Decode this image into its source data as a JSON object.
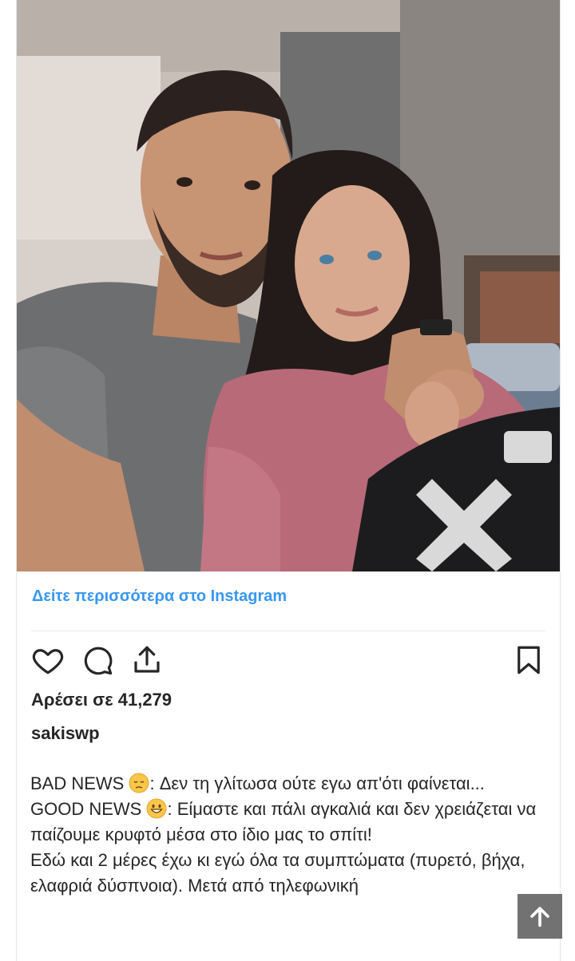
{
  "post": {
    "view_more_label": "Δείτε περισσότερα στο Instagram",
    "likes_text": "Αρέσει σε 41,279",
    "username": "sakiswp",
    "caption": {
      "line1_prefix": "BAD NEWS",
      "line1_rest": ": Δεν τη γλίτωσα ούτε εγω απ'ότι φαίνεται...",
      "line2_prefix": "GOOD NEWS",
      "line2_rest": ": Είμαστε και πάλι αγκαλιά και δεν χρειάζεται να παίζουμε κρυφτό μέσα στο ίδιο μας το σπίτι!",
      "line3": "Εδώ και 2 μέρες έχω κι εγώ όλα τα συμπτώματα (πυρετό, βήχα, ελαφριά δύσπνοια). Μετά από τηλεφωνική"
    }
  },
  "icons": {
    "like": "heart-icon",
    "comment": "comment-icon",
    "share": "share-icon",
    "save": "bookmark-icon",
    "scroll_top": "arrow-up-icon",
    "sad_emoji": "pensive-face-emoji",
    "happy_emoji": "grinning-face-emoji"
  },
  "colors": {
    "link_blue": "#3897f0",
    "text": "#262626",
    "scroll_button_bg": "#5f5f5f"
  }
}
